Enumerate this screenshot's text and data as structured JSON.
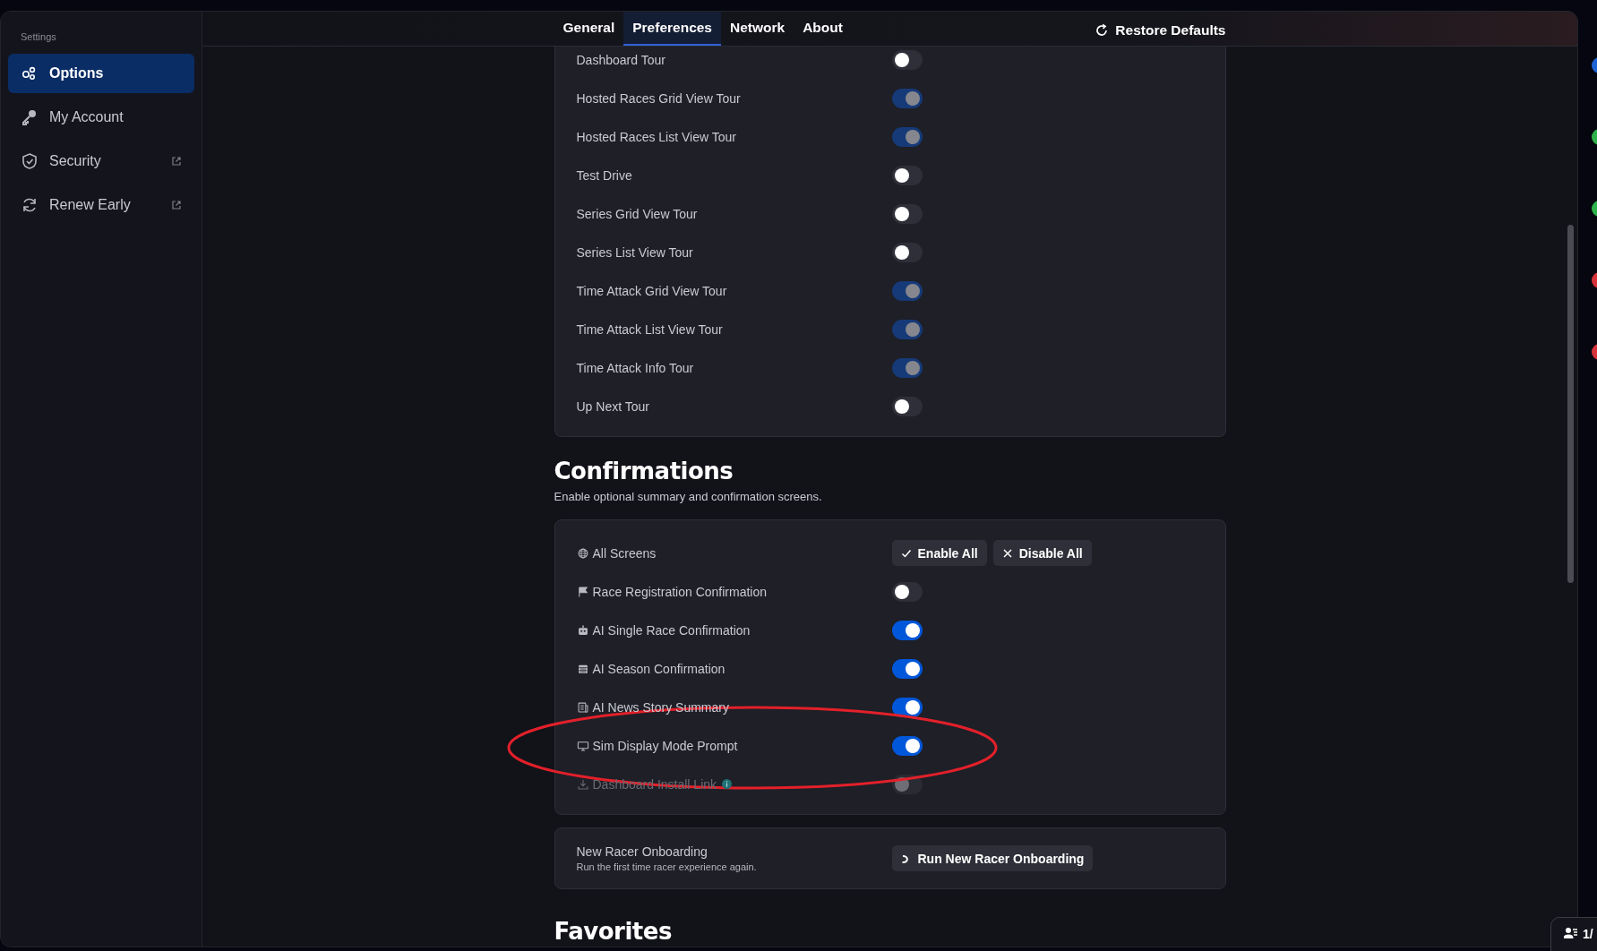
{
  "sidebar": {
    "title": "Settings",
    "items": [
      {
        "label": "Options",
        "external": false,
        "selected": true
      },
      {
        "label": "My Account",
        "external": false,
        "selected": false
      },
      {
        "label": "Security",
        "external": true,
        "selected": false
      },
      {
        "label": "Renew Early",
        "external": true,
        "selected": false
      }
    ]
  },
  "tabs": [
    {
      "label": "General",
      "selected": false
    },
    {
      "label": "Preferences",
      "selected": true
    },
    {
      "label": "Network",
      "selected": false
    },
    {
      "label": "About",
      "selected": false
    }
  ],
  "restore_button": "Restore Defaults",
  "tours": [
    {
      "label": "Dashboard Tour",
      "on": false,
      "disabled": false
    },
    {
      "label": "Hosted Races Grid View Tour",
      "on": true,
      "disabled": true
    },
    {
      "label": "Hosted Races List View Tour",
      "on": true,
      "disabled": true
    },
    {
      "label": "Test Drive",
      "on": false,
      "disabled": false
    },
    {
      "label": "Series Grid View Tour",
      "on": false,
      "disabled": false
    },
    {
      "label": "Series List View Tour",
      "on": false,
      "disabled": false
    },
    {
      "label": "Time Attack Grid View Tour",
      "on": true,
      "disabled": true
    },
    {
      "label": "Time Attack List View Tour",
      "on": true,
      "disabled": true
    },
    {
      "label": "Time Attack Info Tour",
      "on": true,
      "disabled": true
    },
    {
      "label": "Up Next Tour",
      "on": false,
      "disabled": false
    }
  ],
  "confirmations": {
    "title": "Confirmations",
    "subtitle": "Enable optional summary and confirmation screens.",
    "all": {
      "label": "All Screens",
      "enable": "Enable All",
      "disable": "Disable All"
    },
    "items": [
      {
        "label": "Race Registration Confirmation",
        "on": false,
        "disabled": false,
        "info": false
      },
      {
        "label": "AI Single Race Confirmation",
        "on": true,
        "disabled": false,
        "info": false
      },
      {
        "label": "AI Season Confirmation",
        "on": true,
        "disabled": false,
        "info": false
      },
      {
        "label": "AI News Story Summary",
        "on": true,
        "disabled": false,
        "info": false
      },
      {
        "label": "Sim Display Mode Prompt",
        "on": true,
        "disabled": false,
        "info": false
      },
      {
        "label": "Dashboard Install Link",
        "on": false,
        "disabled": true,
        "info": true
      }
    ]
  },
  "onboarding": {
    "title": "New Racer Onboarding",
    "description": "Run the first time racer experience again.",
    "button": "Run New Racer Onboarding"
  },
  "next_section": "Favorites",
  "highlight": {
    "kind": "ellipse"
  },
  "edge_dots": [
    {
      "color": "#1e63d6"
    },
    {
      "color": "#2db34a"
    },
    {
      "color": "#2db34a"
    },
    {
      "color": "#d8333a"
    },
    {
      "color": "#d8333a"
    }
  ],
  "corner_badge": "1/"
}
